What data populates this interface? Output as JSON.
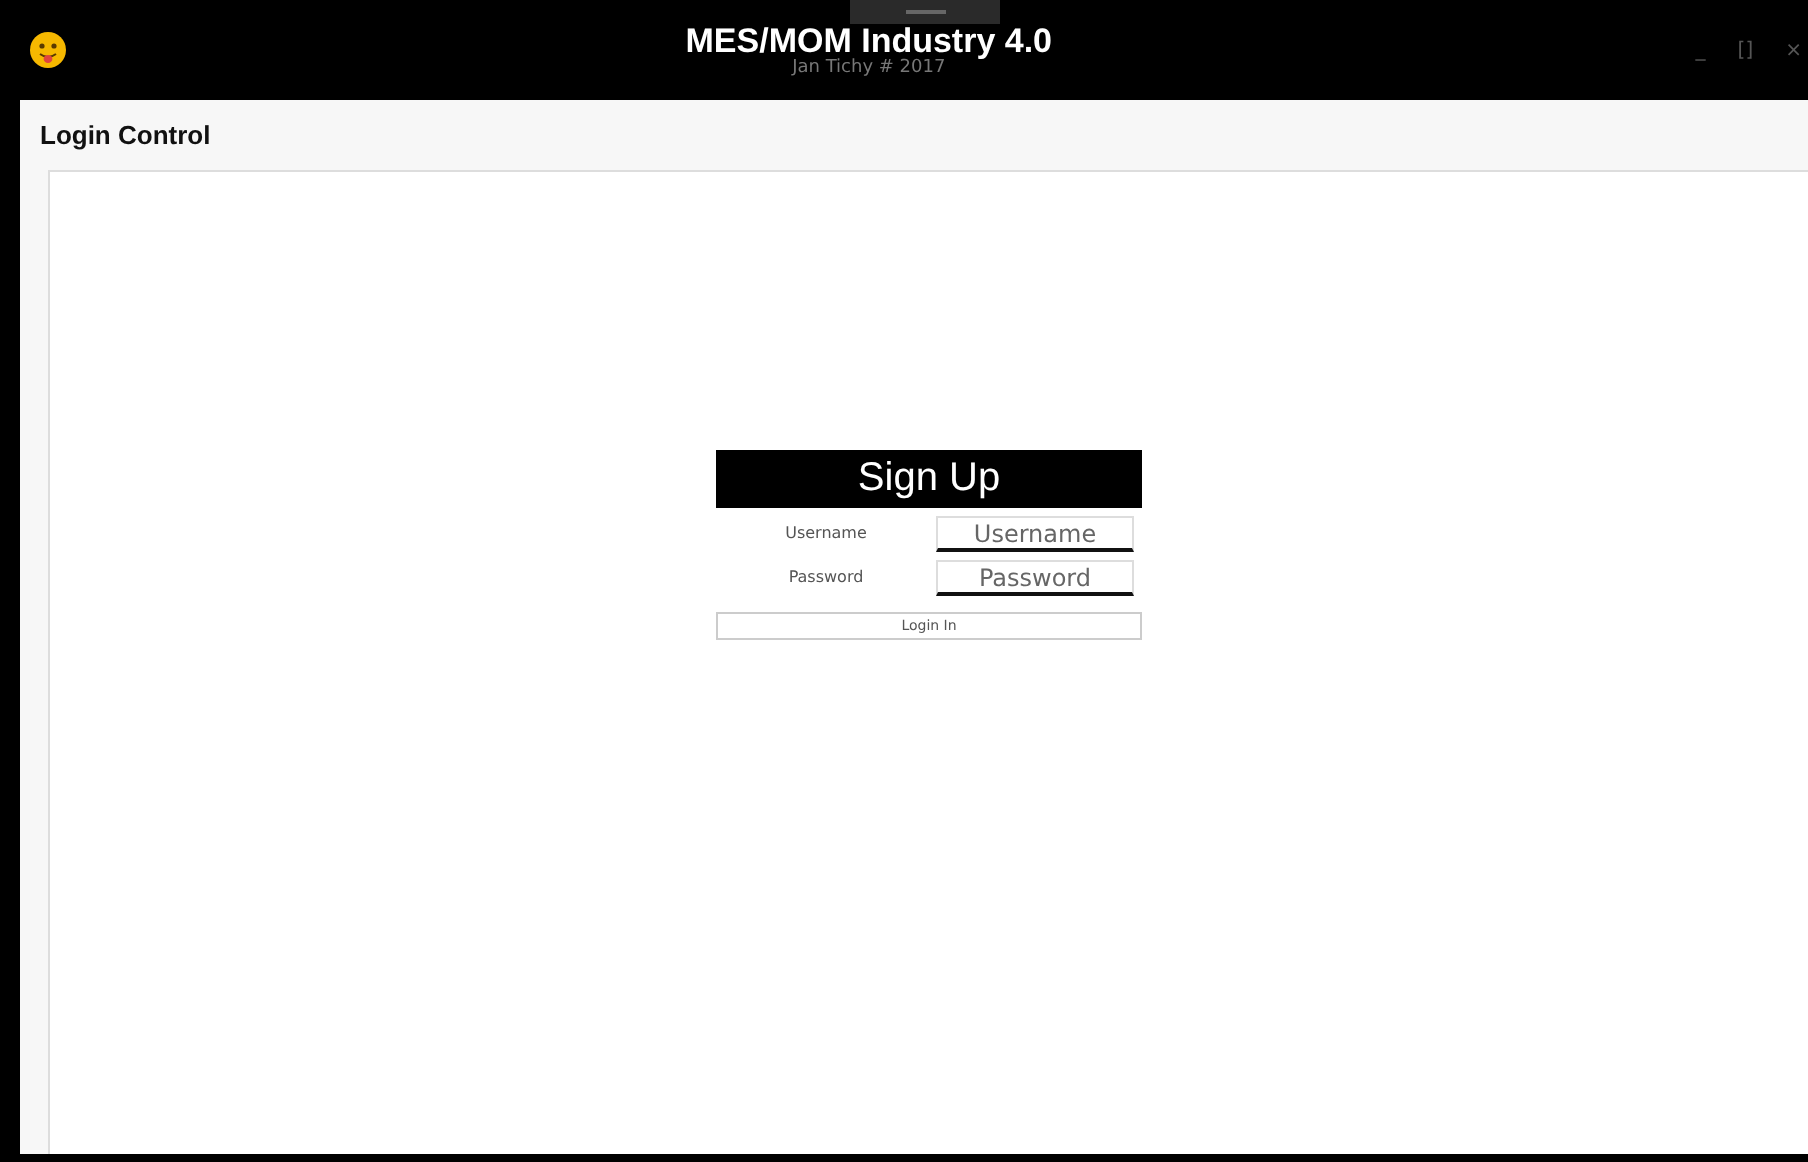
{
  "window": {
    "title": "MES/MOM Industry 4.0",
    "subtitle": "Jan Tichy # 2017",
    "controls": [
      "_",
      "[]",
      "×"
    ]
  },
  "section_title": "Login Control",
  "login": {
    "heading": "Sign Up",
    "fields": [
      {
        "label": "Username",
        "placeholder": "Username"
      },
      {
        "label": "Password",
        "placeholder": "Password"
      }
    ],
    "button": "Login In"
  }
}
